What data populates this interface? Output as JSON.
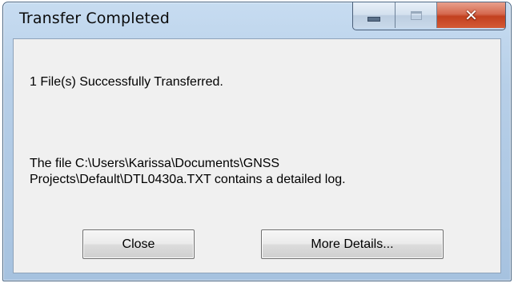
{
  "window": {
    "title": "Transfer Completed",
    "close_glyph": "✕"
  },
  "message": {
    "summary": "1 File(s) Successfully Transferred.",
    "log_line_1": "The file C:\\Users\\Karissa\\Documents\\GNSS",
    "log_line_2": "Projects\\Default\\DTL0430a.TXT contains a detailed log."
  },
  "buttons": {
    "close_label": "Close",
    "details_label": "More Details..."
  },
  "icons": {
    "minimize": "minimize-icon",
    "maximize": "maximize-icon",
    "close": "close-icon"
  },
  "colors": {
    "frame": "#b7cfe8",
    "close_button": "#c2401f",
    "client_background": "#f0f0f0"
  }
}
